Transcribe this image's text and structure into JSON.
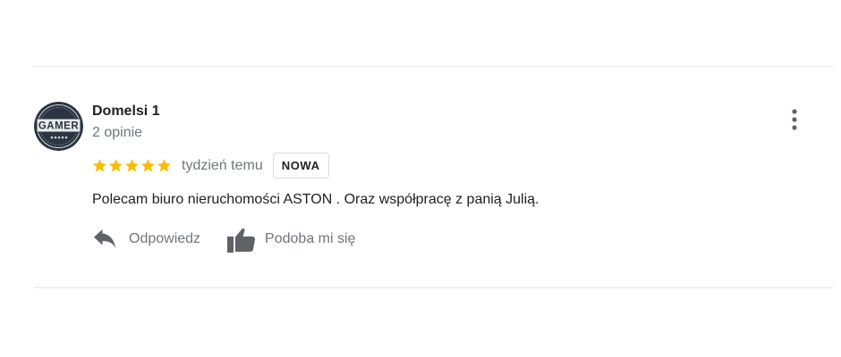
{
  "review": {
    "author": {
      "name": "Domelsi 1",
      "meta": "2 opinie",
      "avatar_icon": "gamer-badge-avatar",
      "avatar_text": "GAMER"
    },
    "rating": {
      "stars": 5,
      "max_stars": 5,
      "star_color": "#fbbc04"
    },
    "time": "tydzień temu",
    "badge": "NOWA",
    "text": "Polecam biuro nieruchomości ASTON . Oraz współpracę z panią Julią.",
    "actions": {
      "reply_label": "Odpowiedz",
      "reply_icon": "reply-arrow-icon",
      "like_label": "Podoba mi się",
      "like_icon": "thumbs-up-icon"
    },
    "more_icon": "more-vertical-icon"
  },
  "colors": {
    "text_primary": "#202124",
    "text_secondary": "#70757a",
    "divider": "#e6e6e6",
    "icon": "#5f6368"
  }
}
